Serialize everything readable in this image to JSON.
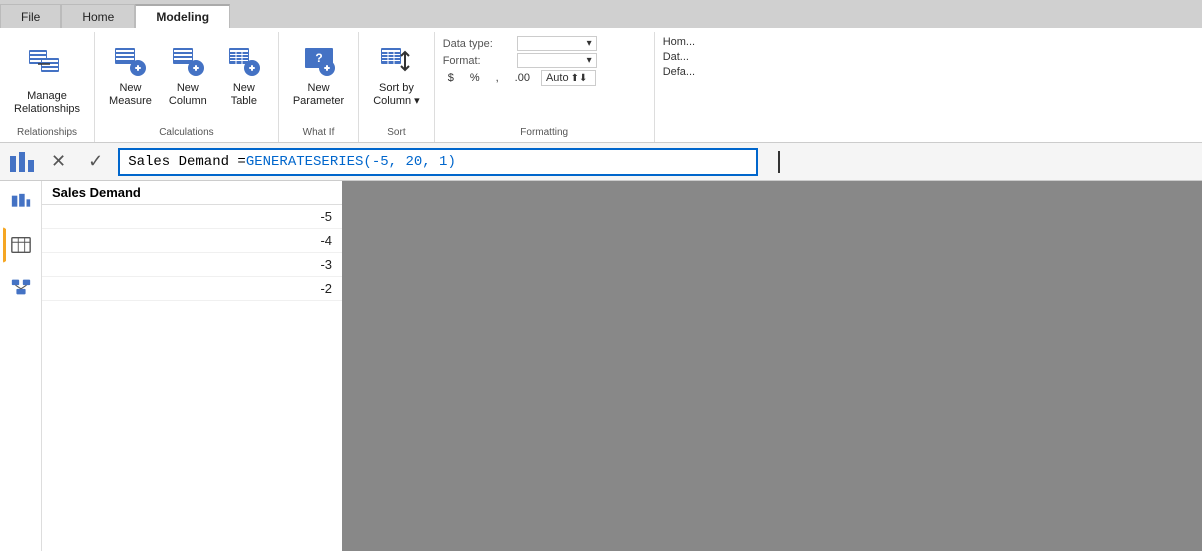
{
  "tabs": [
    {
      "id": "file",
      "label": "File",
      "active": false
    },
    {
      "id": "home",
      "label": "Home",
      "active": false
    },
    {
      "id": "modeling",
      "label": "Modeling",
      "active": true
    }
  ],
  "ribbon": {
    "groups": [
      {
        "id": "relationships",
        "label": "Relationships",
        "items": [
          {
            "id": "manage-relationships",
            "label": "Manage\nRelationships",
            "size": "large"
          }
        ]
      },
      {
        "id": "calculations",
        "label": "Calculations",
        "items": [
          {
            "id": "new-measure",
            "label": "New\nMeasure"
          },
          {
            "id": "new-column",
            "label": "New\nColumn"
          },
          {
            "id": "new-table",
            "label": "New\nTable"
          }
        ]
      },
      {
        "id": "what-if",
        "label": "What If",
        "items": [
          {
            "id": "new-parameter",
            "label": "New\nParameter"
          }
        ]
      },
      {
        "id": "sort",
        "label": "Sort",
        "items": [
          {
            "id": "sort-by-column",
            "label": "Sort by\nColumn ▾"
          }
        ]
      }
    ],
    "formatting": {
      "label": "Formatting",
      "data_type_label": "Data type:",
      "format_label": "Format:",
      "default_sum_label": "Default Sum...",
      "symbols": [
        "$",
        "%",
        ",",
        ".00"
      ],
      "auto_label": "Auto"
    }
  },
  "formula_bar": {
    "formula_text": "Sales Demand = GENERATESERIES(-5, 20, 1)",
    "formula_black": "Sales Demand = ",
    "formula_blue": "GENERATESERIES(-5, 20, 1)"
  },
  "table": {
    "header": "Sales Demand",
    "rows": [
      {
        "value": "-5"
      },
      {
        "value": "-4"
      },
      {
        "value": "-3"
      },
      {
        "value": "-2"
      }
    ]
  }
}
